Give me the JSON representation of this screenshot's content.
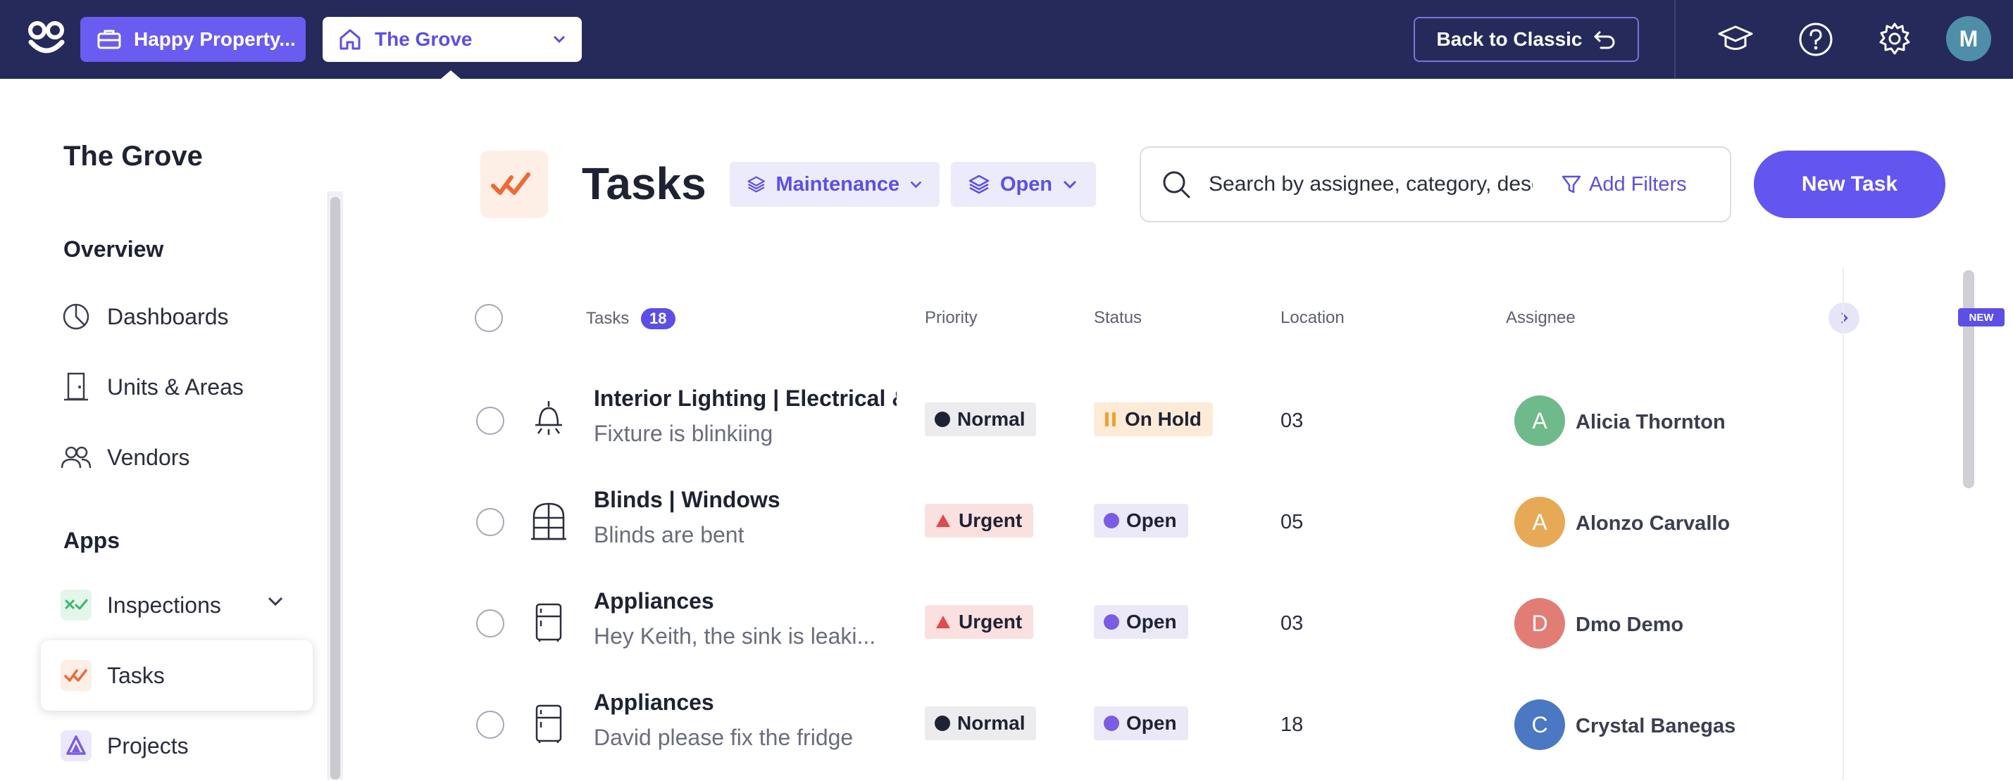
{
  "topbar": {
    "org_label": "Happy Property...",
    "property_label": "The Grove",
    "back_label": "Back to Classic",
    "user_initial": "M"
  },
  "sidebar": {
    "title": "The Grove",
    "overview_heading": "Overview",
    "apps_heading": "Apps",
    "items": [
      {
        "label": "Dashboards",
        "icon": "pie-chart-icon"
      },
      {
        "label": "Units & Areas",
        "icon": "door-icon"
      },
      {
        "label": "Vendors",
        "icon": "users-icon"
      },
      {
        "label": "Inspections",
        "icon": "inspections-icon"
      },
      {
        "label": "Tasks",
        "icon": "tasks-check-icon"
      },
      {
        "label": "Projects",
        "icon": "projects-icon"
      }
    ]
  },
  "header": {
    "title": "Tasks",
    "filter_type": "Maintenance",
    "filter_status": "Open",
    "search_placeholder": "Search by assignee, category, descri",
    "add_filters": "Add Filters",
    "new_task": "New Task"
  },
  "table": {
    "headers": {
      "tasks": "Tasks",
      "count": "18",
      "priority": "Priority",
      "status": "Status",
      "location": "Location",
      "assignee": "Assignee"
    },
    "new_badge": "NEW",
    "rows": [
      {
        "title": "Interior Lighting | Electrical & L",
        "desc": "Fixture is blinkiing",
        "icon": "ceiling-light-icon",
        "priority": "Normal",
        "status": "On Hold",
        "location": "03",
        "initial": "A",
        "assignee": "Alicia Thornton",
        "avatar_color": "#6fba8a"
      },
      {
        "title": "Blinds | Windows",
        "desc": "Blinds are bent",
        "icon": "window-icon",
        "priority": "Urgent",
        "status": "Open",
        "location": "05",
        "initial": "A",
        "assignee": "Alonzo Carvallo",
        "avatar_color": "#e7a955"
      },
      {
        "title": "Appliances",
        "desc": "Hey Keith, the sink is leaki...",
        "icon": "fridge-icon",
        "priority": "Urgent",
        "status": "Open",
        "location": "03",
        "initial": "D",
        "assignee": "Dmo Demo",
        "avatar_color": "#e27d76"
      },
      {
        "title": "Appliances",
        "desc": "David please fix the fridge",
        "icon": "fridge-icon",
        "priority": "Normal",
        "status": "Open",
        "location": "18",
        "initial": "C",
        "assignee": "Crystal Banegas",
        "avatar_color": "#4a78c2"
      }
    ]
  },
  "colors": {
    "brand": "#5b4fe6",
    "topbar": "#252a5b",
    "urgent": "#e04b4b",
    "open": "#7b5ce3",
    "onhold": "#f0a033"
  }
}
